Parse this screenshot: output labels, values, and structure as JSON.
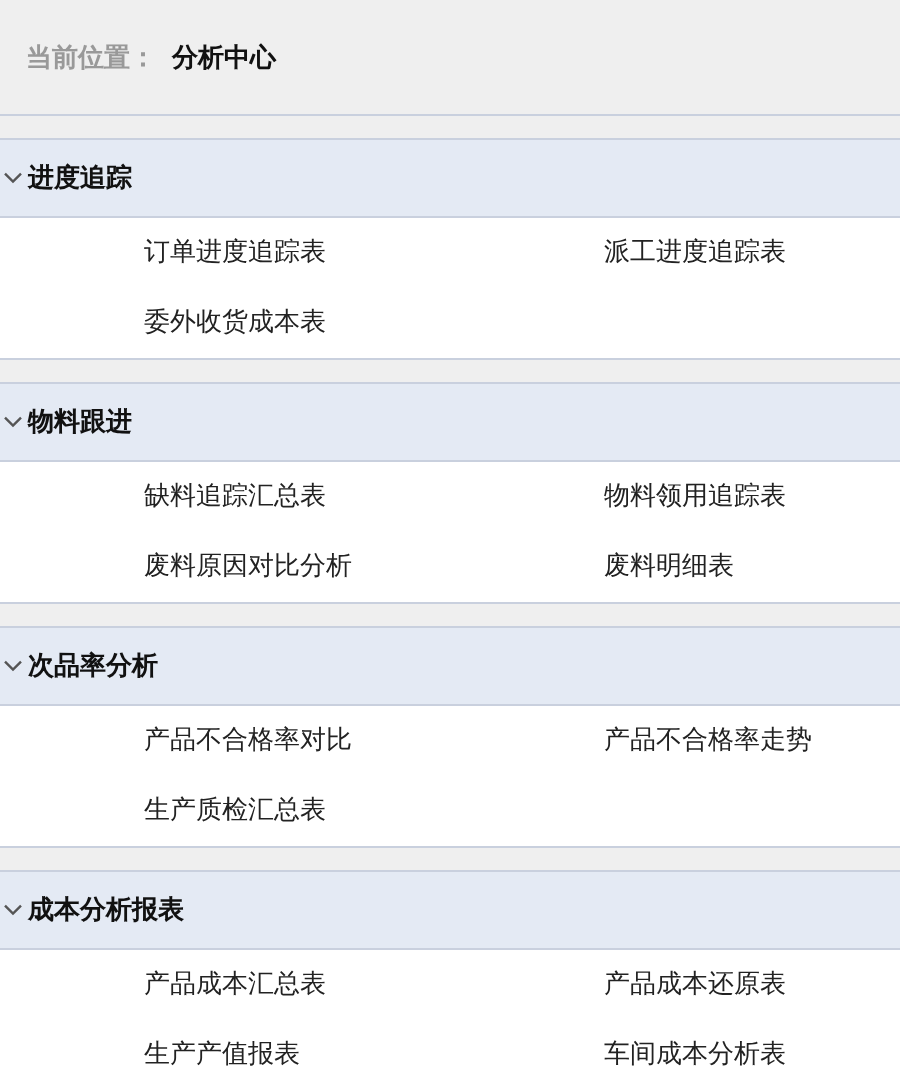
{
  "breadcrumb": {
    "label": "当前位置：",
    "current": "分析中心"
  },
  "sections": [
    {
      "title": "进度追踪",
      "expanded": true,
      "items": [
        "订单进度追踪表",
        "派工进度追踪表",
        "委外收货成本表"
      ]
    },
    {
      "title": "物料跟进",
      "expanded": true,
      "items": [
        "缺料追踪汇总表",
        "物料领用追踪表",
        "废料原因对比分析",
        "废料明细表"
      ]
    },
    {
      "title": "次品率分析",
      "expanded": true,
      "items": [
        "产品不合格率对比",
        "产品不合格率走势",
        "生产质检汇总表"
      ]
    },
    {
      "title": "成本分析报表",
      "expanded": true,
      "items": [
        "产品成本汇总表",
        "产品成本还原表",
        "生产产值报表",
        "车间成本分析表"
      ]
    }
  ]
}
